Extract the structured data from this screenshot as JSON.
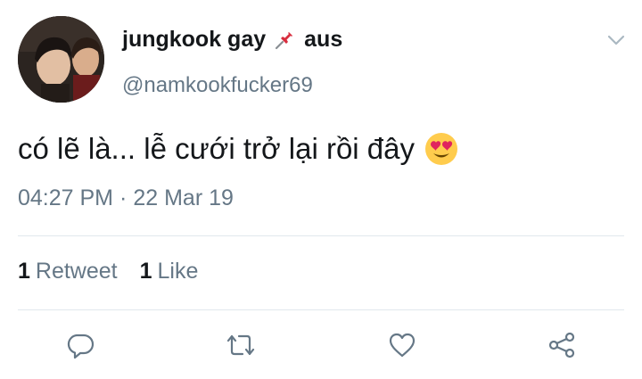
{
  "user": {
    "display_name": "jungkook gay",
    "location_emoji": "pushpin-icon",
    "location_text": "aus",
    "handle": "@namkookfucker69"
  },
  "tweet": {
    "text": "có lẽ là... lễ cưới trở lại rồi đây",
    "emoji": "heart-eyes-emoji"
  },
  "timestamp": {
    "time": "04:27 PM",
    "separator": "·",
    "date": "22 Mar 19"
  },
  "stats": {
    "retweets_count": "1",
    "retweets_label": "Retweet",
    "likes_count": "1",
    "likes_label": "Like"
  },
  "actions": [
    "reply-icon",
    "retweet-icon",
    "like-icon",
    "share-icon"
  ],
  "colors": {
    "text_primary": "#14171a",
    "text_secondary": "#657786",
    "divider": "#e1e8ed",
    "pin_red": "#d82e3f"
  }
}
